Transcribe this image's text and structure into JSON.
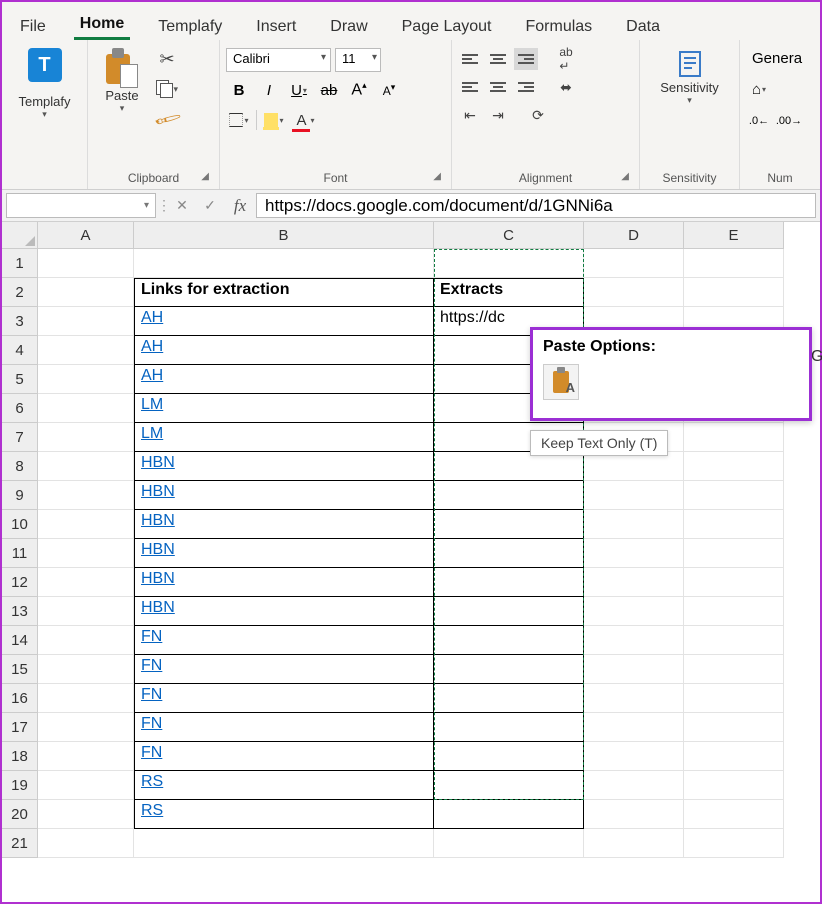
{
  "tabs": [
    "File",
    "Home",
    "Templafy",
    "Insert",
    "Draw",
    "Page Layout",
    "Formulas",
    "Data"
  ],
  "activeTab": "Home",
  "ribbon": {
    "templafy": {
      "label": "Templafy"
    },
    "clipboard": {
      "paste": "Paste",
      "label": "Clipboard"
    },
    "font": {
      "name": "Calibri",
      "size": "11",
      "label": "Font"
    },
    "alignment": {
      "label": "Alignment",
      "wrap": "ab",
      "merge": ""
    },
    "sensitivity": {
      "label": "Sensitivity",
      "btn": "Sensitivity"
    },
    "number": {
      "label": "Num",
      "format": "Genera"
    }
  },
  "namebox": "",
  "formula": "https://docs.google.com/document/d/1GNNi6a",
  "columns": [
    "A",
    "B",
    "C",
    "D",
    "E"
  ],
  "rows": [
    "1",
    "2",
    "3",
    "4",
    "5",
    "6",
    "7",
    "8",
    "9",
    "10",
    "11",
    "12",
    "13",
    "14",
    "15",
    "16",
    "17",
    "18",
    "19",
    "20",
    "21"
  ],
  "headers": {
    "b": "Links for extraction",
    "c": "Extracts"
  },
  "links": [
    "AH",
    "AH",
    "AH",
    "LM",
    "LM",
    "HBN",
    "HBN",
    "HBN",
    "HBN",
    "HBN",
    "HBN",
    "FN",
    "FN",
    "FN",
    "FN",
    "FN",
    "RS",
    "RS"
  ],
  "c3": "https://dc",
  "overflow_char": "G",
  "paste_popup": {
    "title": "Paste Options:",
    "tooltip": "Keep Text Only (T)"
  }
}
